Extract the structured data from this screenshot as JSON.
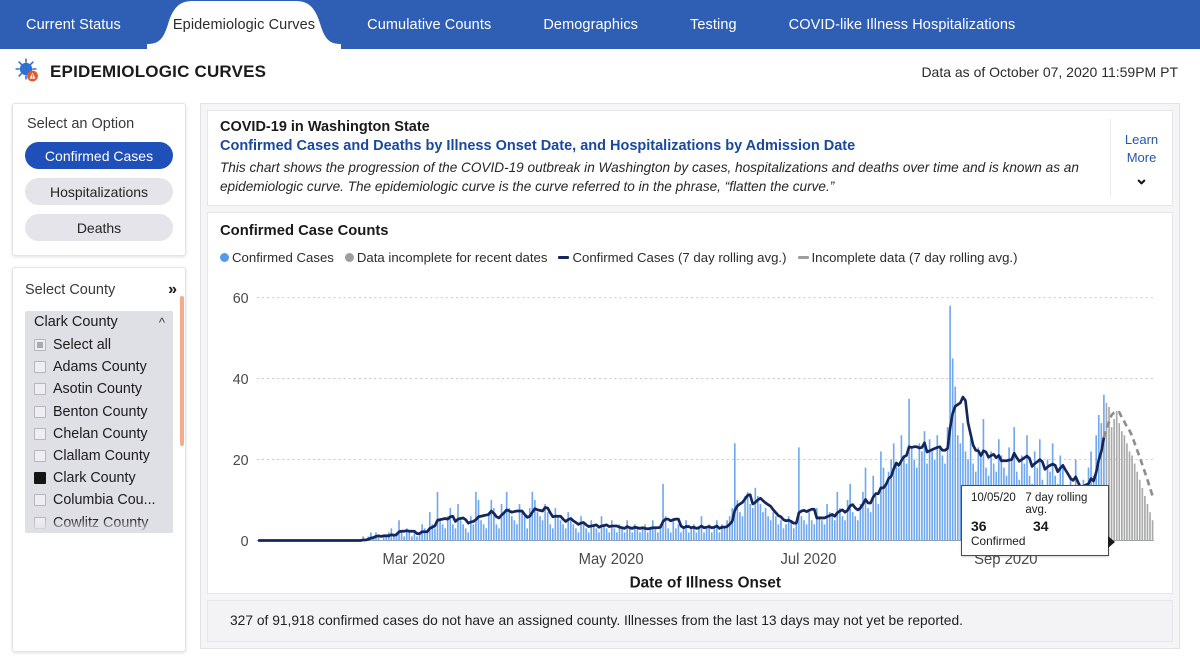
{
  "tabs": [
    {
      "label": "Current Status",
      "active": false
    },
    {
      "label": "Epidemiologic Curves",
      "active": true
    },
    {
      "label": "Cumulative Counts",
      "active": false
    },
    {
      "label": "Demographics",
      "active": false
    },
    {
      "label": "Testing",
      "active": false
    },
    {
      "label": "COVID-like Illness Hospitalizations",
      "active": false
    }
  ],
  "header": {
    "title": "EPIDEMIOLOGIC CURVES",
    "as_of": "Data as of October 07, 2020 11:59PM PT",
    "logo_icon": "virus-icon"
  },
  "sidebar": {
    "option_group_title": "Select an Option",
    "options": [
      {
        "label": "Confirmed Cases",
        "selected": true
      },
      {
        "label": "Hospitalizations",
        "selected": false
      },
      {
        "label": "Deaths",
        "selected": false
      }
    ],
    "county_group_title": "Select County",
    "expand_icon": "chevron-double-right-icon",
    "dropdown": {
      "selected_label": "Clark County",
      "collapse_icon": "chevron-up-icon",
      "items": [
        {
          "label": "Select all",
          "state": "partial"
        },
        {
          "label": "Adams County",
          "state": "unchecked"
        },
        {
          "label": "Asotin County",
          "state": "unchecked"
        },
        {
          "label": "Benton County",
          "state": "unchecked"
        },
        {
          "label": "Chelan County",
          "state": "unchecked"
        },
        {
          "label": "Clallam County",
          "state": "unchecked"
        },
        {
          "label": "Clark County",
          "state": "checked"
        },
        {
          "label": "Columbia Cou...",
          "state": "unchecked"
        },
        {
          "label": "Cowlitz County",
          "state": "unchecked"
        }
      ]
    }
  },
  "intro": {
    "line1": "COVID-19 in Washington State",
    "line2": "Confirmed Cases and Deaths by Illness Onset Date, and Hospitalizations by Admission Date",
    "paragraph": "This chart shows the progression of the COVID-19 outbreak in Washington by cases, hospitalizations and deaths over time and is known as an epidemiologic curve. The epidemiologic curve is the curve referred to in the phrase, “flatten the curve.”",
    "learn_more_line1": "Learn",
    "learn_more_line2": "More",
    "expand_icon": "chevron-double-down-icon"
  },
  "tooltip": {
    "date": "10/05/20",
    "series_label": "7 day rolling avg.",
    "value": "36",
    "avg_value": "34",
    "metric": "Confirmed"
  },
  "footnote": {
    "text": "327 of 91,918 confirmed cases do not have an assigned county. Illnesses from the last 13 days may not yet be reported."
  },
  "colors": {
    "brand_blue": "#2f5fb5",
    "pill_selected": "#1f4fb8",
    "bar_blue": "#6fa8ef",
    "bar_gray": "#a8a8a8",
    "line_navy": "#14265c",
    "line_gray": "#8e8e8e",
    "link_blue": "#18499e"
  },
  "chart_data": {
    "type": "bar",
    "title": "Confirmed Case Counts",
    "xlabel": "Date of Illness Onset",
    "ylabel": "",
    "ylim": [
      0,
      62
    ],
    "yticks": [
      0,
      20,
      40,
      60
    ],
    "ytick_labels": [
      "0",
      "20",
      "40",
      "60"
    ],
    "grid": true,
    "legend_position": "top",
    "legend": [
      {
        "label": "Confirmed Cases",
        "marker": "dot",
        "color": "#539aea"
      },
      {
        "label": "Data incomplete for recent dates",
        "marker": "dot",
        "color": "#9e9e9e"
      },
      {
        "label": "Confirmed Cases (7 day rolling avg.)",
        "marker": "dash",
        "color": "#14265c"
      },
      {
        "label": "Incomplete data (7 day rolling avg.)",
        "marker": "dash",
        "color": "#9e9e9e"
      }
    ],
    "xtick_labels": [
      "Mar 2020",
      "May 2020",
      "Jul 2020",
      "Sep 2020"
    ],
    "xtick_positions": [
      0.175,
      0.395,
      0.615,
      0.835
    ],
    "series": [
      {
        "name": "Confirmed Cases",
        "type": "bar",
        "color": "#6fa8ef",
        "values": [
          0,
          0,
          0,
          0,
          0,
          0,
          0,
          0,
          0,
          0,
          0,
          0,
          0,
          0,
          0,
          0,
          0,
          0,
          0,
          0,
          0,
          0,
          0,
          0,
          0,
          0,
          0,
          0,
          0,
          0,
          0,
          0,
          0,
          0,
          0,
          0,
          0,
          0,
          0,
          0,
          0,
          1,
          0,
          1,
          2,
          1,
          2,
          1,
          0,
          1,
          1,
          2,
          3,
          1,
          2,
          5,
          2,
          1,
          3,
          2,
          1,
          2,
          1,
          2,
          4,
          3,
          2,
          7,
          4,
          3,
          12,
          5,
          4,
          3,
          6,
          8,
          4,
          3,
          9,
          5,
          4,
          3,
          2,
          6,
          4,
          12,
          10,
          5,
          4,
          3,
          7,
          10,
          8,
          4,
          3,
          9,
          7,
          12,
          8,
          6,
          5,
          4,
          9,
          7,
          6,
          3,
          8,
          12,
          10,
          7,
          6,
          5,
          9,
          7,
          4,
          3,
          8,
          6,
          5,
          4,
          3,
          7,
          5,
          4,
          3,
          2,
          6,
          4,
          3,
          2,
          5,
          4,
          3,
          2,
          6,
          4,
          3,
          2,
          5,
          3,
          2,
          4,
          3,
          2,
          5,
          3,
          2,
          4,
          3,
          2,
          3,
          4,
          2,
          3,
          5,
          3,
          2,
          4,
          14,
          6,
          3,
          2,
          5,
          3,
          4,
          2,
          3,
          5,
          2,
          3,
          4,
          2,
          3,
          6,
          2,
          3,
          4,
          2,
          3,
          5,
          2,
          4,
          3,
          5,
          6,
          8,
          24,
          10,
          7,
          6,
          11,
          12,
          9,
          8,
          13,
          11,
          9,
          7,
          8,
          6,
          5,
          7,
          6,
          4,
          5,
          3,
          4,
          6,
          5,
          3,
          4,
          23,
          6,
          5,
          4,
          7,
          5,
          4,
          8,
          6,
          5,
          4,
          9,
          7,
          6,
          5,
          12,
          8,
          6,
          5,
          10,
          14,
          7,
          6,
          5,
          9,
          12,
          18,
          8,
          7,
          16,
          11,
          9,
          22,
          18,
          14,
          17,
          20,
          24,
          19,
          18,
          26,
          21,
          19,
          35,
          23,
          20,
          18,
          24,
          22,
          27,
          19,
          25,
          22,
          20,
          26,
          23,
          21,
          19,
          28,
          58,
          45,
          38,
          26,
          24,
          29,
          22,
          20,
          25,
          19,
          17,
          23,
          21,
          30,
          18,
          16,
          22,
          19,
          17,
          25,
          21,
          18,
          16,
          23,
          20,
          28,
          17,
          15,
          21,
          19,
          26,
          16,
          14,
          22,
          18,
          25,
          15,
          13,
          20,
          17,
          24,
          16,
          14,
          21,
          18,
          12,
          10,
          16,
          13,
          20,
          11,
          9,
          15,
          12,
          18,
          22,
          16,
          26,
          31,
          29,
          36,
          34,
          33,
          28,
          30,
          32,
          29,
          27,
          26,
          24,
          22,
          21,
          19,
          17,
          15,
          13,
          11,
          9,
          7,
          5
        ]
      }
    ],
    "rolling_average": {
      "name": "Confirmed Cases (7 day rolling avg.)",
      "color": "#14265c",
      "tooltip_point": {
        "date": "10/05/20",
        "cases": 36,
        "avg": 34
      }
    },
    "incomplete_tail_days": 19,
    "notes": "Last ~19 days shown in gray as incomplete data; rolling average shown dashed gray over that span."
  }
}
